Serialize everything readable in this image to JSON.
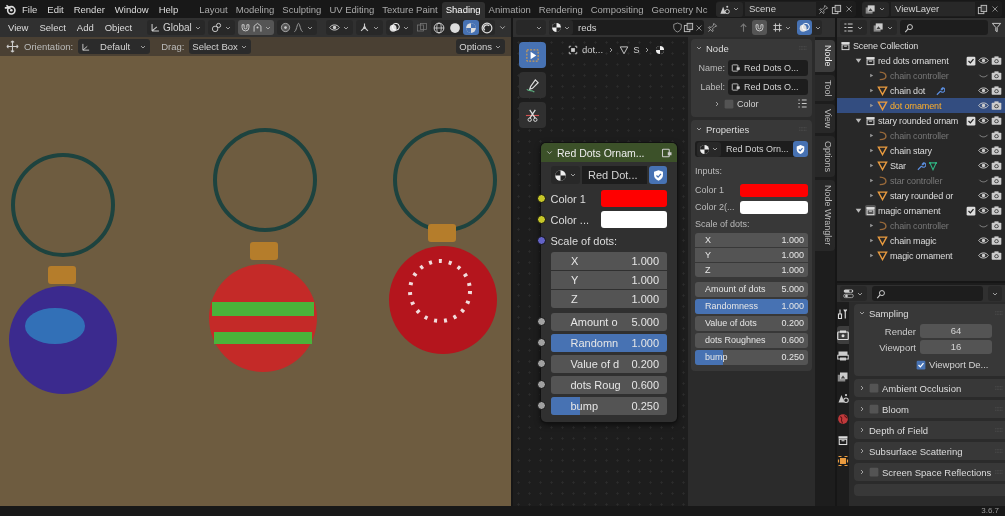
{
  "menu": [
    "File",
    "Edit",
    "Render",
    "Window",
    "Help"
  ],
  "workspaces": [
    {
      "label": "Layout",
      "selected": false
    },
    {
      "label": "Modeling",
      "selected": false
    },
    {
      "label": "Sculpting",
      "selected": false
    },
    {
      "label": "UV Editing",
      "selected": false
    },
    {
      "label": "Texture Paint",
      "selected": false
    },
    {
      "label": "Shading",
      "selected": true
    },
    {
      "label": "Animation",
      "selected": false
    },
    {
      "label": "Rendering",
      "selected": false
    },
    {
      "label": "Compositing",
      "selected": false
    },
    {
      "label": "Geometry Nc",
      "selected": false
    }
  ],
  "scene": "Scene",
  "view_layer": "ViewLayer",
  "viewport": {
    "menu": [
      "View",
      "Select",
      "Add",
      "Object"
    ],
    "transform_orientation": "Global",
    "shading": [
      {
        "kind": "wireframe",
        "selected": false
      },
      {
        "kind": "solid",
        "selected": false
      },
      {
        "kind": "material",
        "selected": true
      },
      {
        "kind": "rendered",
        "selected": false
      }
    ],
    "tool_settings": {
      "orientation_label": "Orientation:",
      "orientation": "Default",
      "drag_label": "Drag:",
      "drag": "Select Box",
      "options": "Options"
    }
  },
  "node_editor": {
    "material": "reds",
    "breadcrumb": [
      "dot...",
      "S"
    ],
    "tools": [
      {
        "kind": "select",
        "selected": true
      },
      {
        "kind": "annotate",
        "selected": false
      },
      {
        "kind": "cut",
        "selected": false
      }
    ],
    "node": {
      "title": "Red Dots Ornam...",
      "group": "Red Dot...",
      "inputs": [
        {
          "kind": "color",
          "label": "Color 1",
          "color": "#ff0000"
        },
        {
          "kind": "color",
          "label": "Color ...",
          "color": "#ffffff"
        },
        {
          "kind": "vector",
          "label": "Scale of dots:",
          "fields": [
            {
              "label": "X",
              "value": "1.000"
            },
            {
              "label": "Y",
              "value": "1.000"
            },
            {
              "label": "Z",
              "value": "1.000"
            }
          ]
        },
        {
          "kind": "number",
          "label": "Amount o",
          "value": "5.000"
        },
        {
          "kind": "slider",
          "label": "Randomn",
          "value": "1.000",
          "level": 1
        },
        {
          "kind": "number",
          "label": "Value of d",
          "value": "0.200"
        },
        {
          "kind": "number",
          "label": "dots Roug",
          "value": "0.600"
        },
        {
          "kind": "slider",
          "label": "bump",
          "value": "0.250",
          "level": 0.25
        }
      ]
    }
  },
  "sidebar": {
    "tabs": [
      {
        "label": "Node",
        "selected": true
      },
      {
        "label": "Tool",
        "selected": false
      },
      {
        "label": "View",
        "selected": false
      },
      {
        "label": "Options",
        "selected": false
      },
      {
        "label": "Node Wrangler",
        "selected": false
      }
    ],
    "node_panel": {
      "title": "Node",
      "expanded": true,
      "name_label": "Name:",
      "name": "Red Dots O...",
      "label_label": "Label:",
      "label": "Red Dots O...",
      "color_option": {
        "label": "Color",
        "checked": false,
        "expanded": false
      }
    },
    "properties_panel": {
      "title": "Properties",
      "expanded": true,
      "group": "Red Dots Orn...",
      "inputs_label": "Inputs:",
      "inputs": [
        {
          "kind": "color",
          "label": "Color 1",
          "color": "#ff0000"
        },
        {
          "kind": "color",
          "label": "Color 2(...",
          "color": "#ffffff"
        },
        {
          "kind": "vector",
          "label": "Scale of dots:",
          "fields": [
            {
              "label": "X",
              "value": "1.000"
            },
            {
              "label": "Y",
              "value": "1.000"
            },
            {
              "label": "Z",
              "value": "1.000"
            }
          ]
        },
        {
          "kind": "number",
          "label": "Amount of dots",
          "value": "5.000"
        },
        {
          "kind": "slider",
          "label": "Randomness",
          "value": "1.000",
          "level": 1
        },
        {
          "kind": "number",
          "label": "Value of dots",
          "value": "0.200"
        },
        {
          "kind": "number",
          "label": "dots Roughnes",
          "value": "0.600"
        },
        {
          "kind": "slider",
          "label": "bump",
          "value": "0.250",
          "level": 0.25
        }
      ]
    }
  },
  "outliner": {
    "tree": [
      {
        "label": "Scene Collection",
        "kind": "scene",
        "children": [
          {
            "label": "red dots ornament",
            "kind": "collection",
            "expanded": true,
            "checked": true,
            "active": false,
            "children": [
              {
                "label": "chain controller",
                "kind": "empty",
                "expanded": false,
                "selected": false,
                "visible": false,
                "modifier": false,
                "mesh_data": false
              },
              {
                "label": "chain dot",
                "kind": "mesh",
                "expanded": false,
                "selected": false,
                "visible": true,
                "modifier": true,
                "mesh_data": false
              },
              {
                "label": "dot ornament",
                "kind": "mesh",
                "expanded": false,
                "selected": true,
                "visible": true,
                "modifier": false,
                "mesh_data": false
              }
            ]
          },
          {
            "label": "stary rounded ornam",
            "kind": "collection",
            "expanded": true,
            "checked": true,
            "active": false,
            "children": [
              {
                "label": "chain controller",
                "kind": "empty",
                "expanded": false,
                "selected": false,
                "visible": false,
                "modifier": false,
                "mesh_data": false
              },
              {
                "label": "chain stary",
                "kind": "mesh",
                "expanded": false,
                "selected": false,
                "visible": true,
                "modifier": false,
                "mesh_data": false
              },
              {
                "label": "Star",
                "kind": "mesh",
                "expanded": false,
                "selected": false,
                "visible": true,
                "modifier": true,
                "mesh_data": true
              },
              {
                "label": "star controller",
                "kind": "empty",
                "expanded": false,
                "selected": false,
                "visible": false,
                "modifier": false,
                "mesh_data": false
              },
              {
                "label": "stary rounded or",
                "kind": "mesh",
                "expanded": false,
                "selected": false,
                "visible": true,
                "modifier": false,
                "mesh_data": false
              }
            ]
          },
          {
            "label": "magic ornament",
            "kind": "collection",
            "expanded": true,
            "checked": true,
            "active": true,
            "children": [
              {
                "label": "chain controller",
                "kind": "empty",
                "expanded": false,
                "selected": false,
                "visible": false,
                "modifier": false,
                "mesh_data": false
              },
              {
                "label": "chain magic",
                "kind": "mesh",
                "expanded": false,
                "selected": false,
                "visible": true,
                "modifier": false,
                "mesh_data": false
              },
              {
                "label": "magic ornament",
                "kind": "mesh",
                "expanded": false,
                "selected": false,
                "visible": true,
                "modifier": false,
                "mesh_data": false
              }
            ]
          }
        ]
      }
    ]
  },
  "properties": {
    "tabs": [
      {
        "kind": "tool",
        "selected": false
      },
      {
        "kind": "render",
        "selected": true
      },
      {
        "kind": "output",
        "selected": false
      },
      {
        "kind": "view_layer",
        "selected": false
      },
      {
        "kind": "scene",
        "selected": false
      },
      {
        "kind": "world",
        "selected": false
      },
      {
        "kind": "collection",
        "selected": false
      },
      {
        "kind": "object",
        "selected": false
      }
    ],
    "panels": [
      {
        "title": "Sampling",
        "kind": "plain",
        "expanded": true,
        "fields": [
          {
            "label": "Render",
            "value": "64"
          },
          {
            "label": "Viewport",
            "value": "16"
          }
        ],
        "option": {
          "label": "Viewport De...",
          "checked": true
        }
      },
      {
        "title": "Ambient Occlusion",
        "kind": "toggle",
        "expanded": false,
        "enabled": false
      },
      {
        "title": "Bloom",
        "kind": "toggle",
        "expanded": false,
        "enabled": false
      },
      {
        "title": "Depth of Field",
        "kind": "plain",
        "expanded": false
      },
      {
        "title": "Subsurface Scattering",
        "kind": "plain",
        "expanded": false
      },
      {
        "title": "Screen Space Reflections",
        "kind": "toggle",
        "expanded": false,
        "enabled": false
      }
    ]
  },
  "status_bar": {
    "version": "3.6.7"
  }
}
